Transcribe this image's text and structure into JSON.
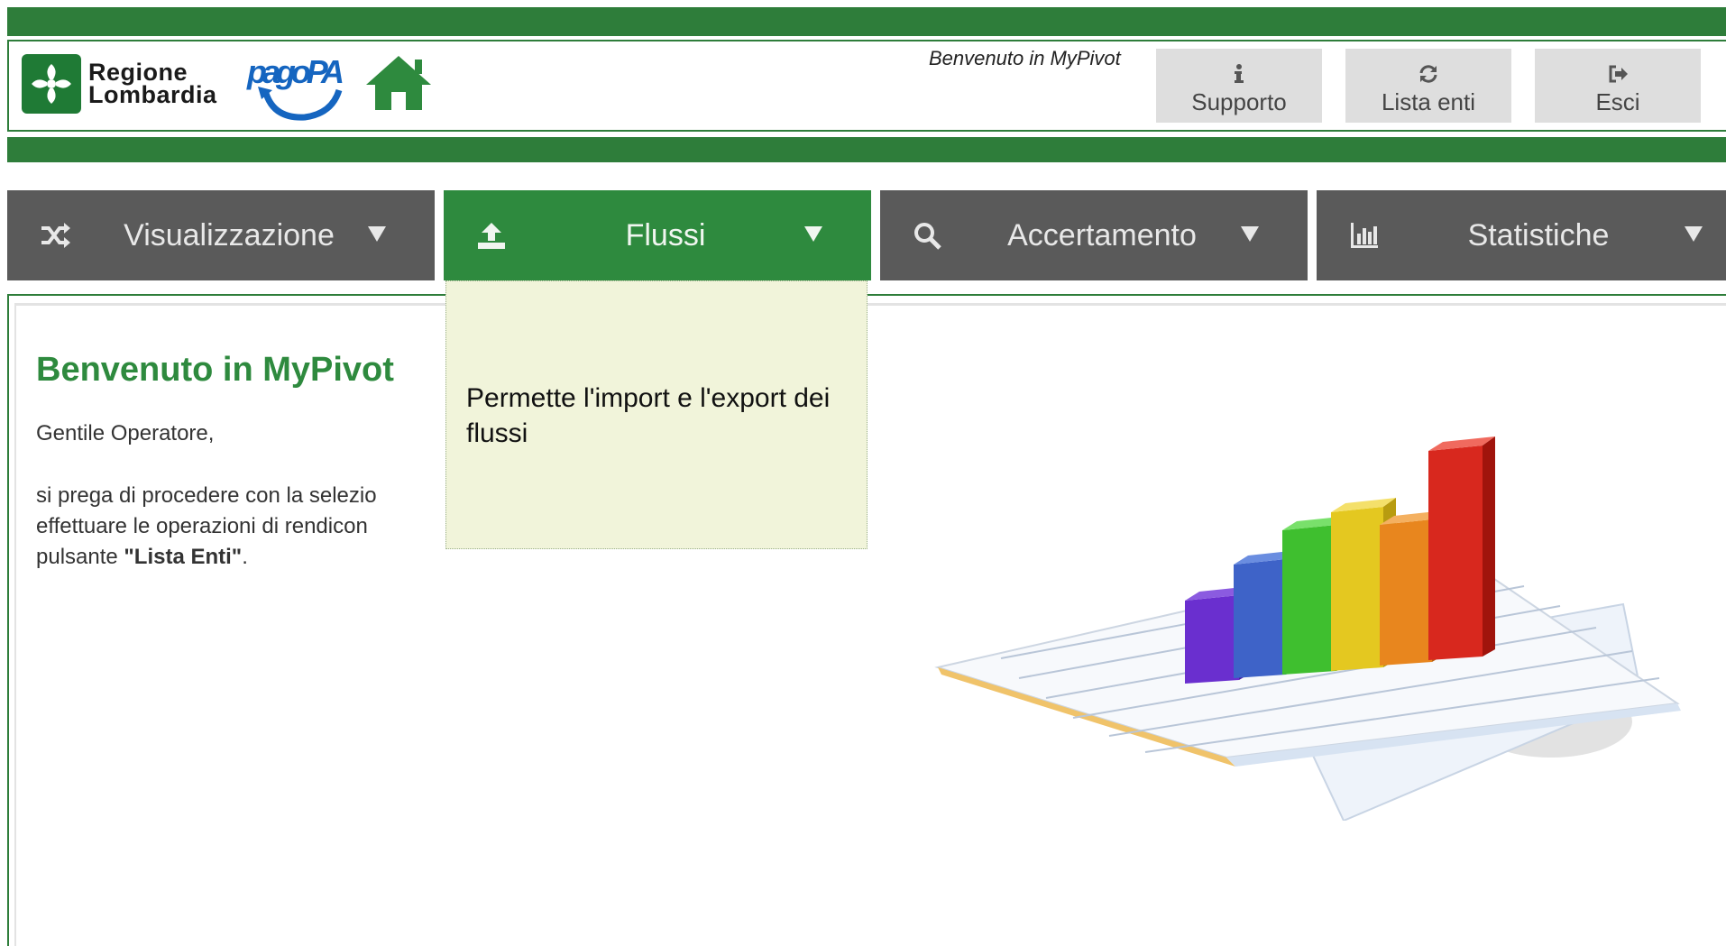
{
  "header": {
    "logo_region_line1": "Regione",
    "logo_region_line2": "Lombardia",
    "logo_pagopa": "pagoPA",
    "welcome_text": "Benvenuto in MyPivot",
    "buttons": [
      {
        "label": "Supporto",
        "icon": "info-icon"
      },
      {
        "label": "Lista enti",
        "icon": "refresh-icon"
      },
      {
        "label": "Esci",
        "icon": "logout-icon"
      }
    ]
  },
  "nav": {
    "items": [
      {
        "label": "Visualizzazione",
        "icon": "shuffle-icon"
      },
      {
        "label": "Flussi",
        "icon": "upload-icon",
        "active": true
      },
      {
        "label": "Accertamento",
        "icon": "search-icon"
      },
      {
        "label": "Statistiche",
        "icon": "bar-chart-icon"
      }
    ]
  },
  "tooltip": {
    "text": "Permette l'import e l'export dei flussi"
  },
  "main": {
    "title": "Benvenuto in MyPivot",
    "greeting": "Gentile Operatore,",
    "body_line1": "si prega di procedere con la selezio",
    "body_line2": "effettuare le operazioni di rendicon",
    "body_line3_prefix": "pulsante ",
    "body_line3_bold": "\"Lista Enti\"",
    "body_line3_suffix": "."
  },
  "colors": {
    "brand_green": "#2e7d3a",
    "nav_active": "#2e8a3e",
    "nav_inactive": "#5a5a5a",
    "tooltip_bg": "#f1f4da"
  }
}
